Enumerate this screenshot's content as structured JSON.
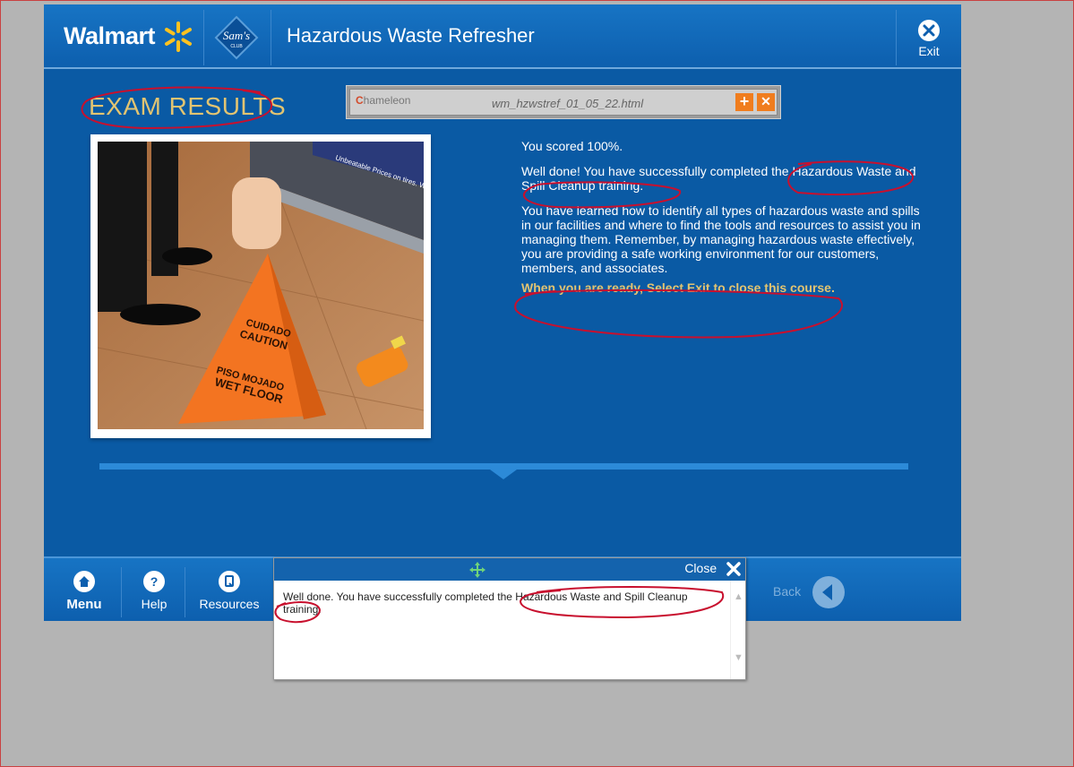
{
  "header": {
    "brand": "Walmart",
    "sams_logo_text": "Sam's",
    "sams_logo_sub": "CLUB",
    "course_title": "Hazardous Waste Refresher",
    "exit_label": "Exit"
  },
  "page": {
    "heading": "EXAM RESULTS"
  },
  "chameleon_bar": {
    "logo": "hameleon",
    "logo_c": "C",
    "filename": "wm_hzwstref_01_05_22.html",
    "plus": "+",
    "close": "✕"
  },
  "photo": {
    "sign_line1": "CUIDADO",
    "sign_line2": "CAUTION",
    "sign_line3": "PISO MOJADO",
    "sign_line4": "WET FLOOR",
    "shelf_text": "Unbeatable Prices on tires. We Guara"
  },
  "results": {
    "score": "You scored 100%.",
    "well_done": "Well done!  You have successfully completed the Hazardous Waste and Spill Cleanup training.",
    "learned": "You have learned how to identify all types of hazardous waste and spills in our facilities and where to find the tools and resources to assist you in managing them.  Remember, by managing hazardous waste effectively, you are providing a safe working environment for our customers, members, and associates.",
    "ready": "When you are ready, Select Exit to close this course."
  },
  "footer": {
    "menu": "Menu",
    "help": "Help",
    "resources": "Resources",
    "back": "Back"
  },
  "popup": {
    "close_label": "Close",
    "text": "Well done.  You have successfully completed the Hazardous Waste and Spill Cleanup training."
  },
  "colors": {
    "app_blue": "#0a5aa4",
    "gold": "#e2c471",
    "spark_yellow": "#ffc220",
    "annotation_red": "#c8102e"
  }
}
